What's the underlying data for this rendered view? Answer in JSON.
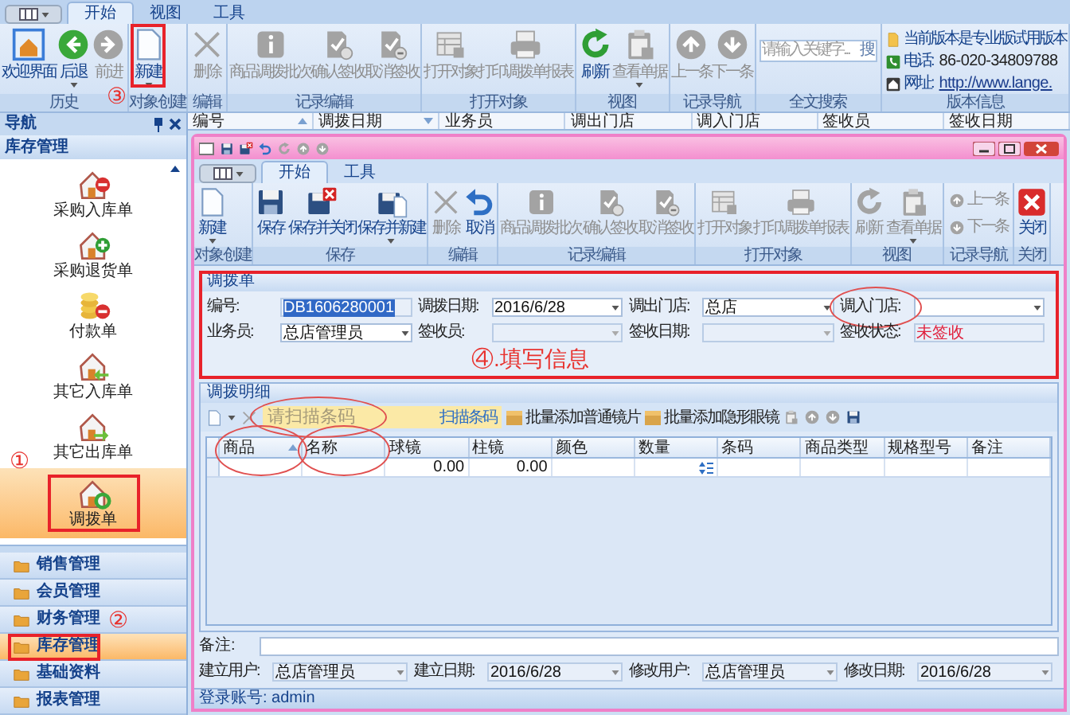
{
  "window_tabs": [
    {
      "label": "开始",
      "selected": true
    },
    {
      "label": "视图",
      "selected": false
    },
    {
      "label": "工具",
      "selected": false
    }
  ],
  "ribbon": [
    {
      "kind": "buttons",
      "label": "历史",
      "annotation": "③",
      "buttons": [
        {
          "label": "欢迎界面",
          "disabled": false,
          "dropdown": false,
          "highlighted": false
        },
        {
          "label": "后退",
          "disabled": false,
          "dropdown": true,
          "highlighted": false
        },
        {
          "label": "前进",
          "disabled": true,
          "dropdown": false,
          "highlighted": false
        }
      ]
    },
    {
      "kind": "buttons",
      "label": "对象创建",
      "buttons": [
        {
          "label": "新建",
          "disabled": false,
          "dropdown": true,
          "highlighted": true
        }
      ]
    },
    {
      "kind": "buttons",
      "label": "编辑",
      "buttons": [
        {
          "label": "删除",
          "disabled": true,
          "dropdown": false,
          "highlighted": false
        }
      ]
    },
    {
      "kind": "buttons",
      "label": "记录编辑",
      "buttons": [
        {
          "label": "商品调拨批次",
          "disabled": true,
          "dropdown": false,
          "highlighted": false
        },
        {
          "label": "确认签收",
          "disabled": true,
          "dropdown": false,
          "highlighted": false
        },
        {
          "label": "取消签收",
          "disabled": true,
          "dropdown": false,
          "highlighted": false
        }
      ]
    },
    {
      "kind": "buttons",
      "label": "打开对象",
      "buttons": [
        {
          "label": "打开对象",
          "disabled": true,
          "dropdown": false,
          "highlighted": false
        },
        {
          "label": "打印调拨单报表",
          "disabled": true,
          "dropdown": false,
          "highlighted": false
        }
      ]
    },
    {
      "kind": "buttons",
      "label": "视图",
      "buttons": [
        {
          "label": "刷新",
          "disabled": false,
          "dropdown": false,
          "highlighted": false
        },
        {
          "label": "查看单据",
          "disabled": true,
          "dropdown": true,
          "highlighted": false
        }
      ]
    },
    {
      "kind": "buttons",
      "label": "记录导航",
      "buttons": [
        {
          "label": "上一条",
          "disabled": true,
          "dropdown": false,
          "highlighted": false
        },
        {
          "label": "下一条",
          "disabled": true,
          "dropdown": false,
          "highlighted": false
        }
      ]
    },
    {
      "kind": "search",
      "label": "全文搜索",
      "placeholder": "请输入关键字...",
      "button": "搜"
    },
    {
      "kind": "info",
      "label": "版本信息",
      "lines": [
        {
          "text": "当前版本是专业版试用版本"
        },
        {
          "text": "电话:",
          "value": "86-020-34809788"
        },
        {
          "text": "网址:",
          "value": "http://www.lange."
        }
      ]
    }
  ],
  "nav": {
    "title": "导航",
    "section": "库存管理",
    "items": [
      {
        "label": "采购入库单",
        "selected": false,
        "highlighted": false
      },
      {
        "label": "采购退货单",
        "selected": false,
        "highlighted": false
      },
      {
        "label": "付款单",
        "selected": false,
        "highlighted": false
      },
      {
        "label": "其它入库单",
        "selected": false,
        "highlighted": false
      },
      {
        "label": "其它出库单",
        "selected": false,
        "highlighted": false
      },
      {
        "label": "调拨单",
        "selected": true,
        "highlighted": true,
        "annotation": "①"
      }
    ],
    "categories": [
      {
        "label": "销售管理",
        "selected": false,
        "highlighted": false
      },
      {
        "label": "会员管理",
        "selected": false,
        "highlighted": false
      },
      {
        "label": "财务管理",
        "selected": false,
        "highlighted": false,
        "annotation": "②"
      },
      {
        "label": "库存管理",
        "selected": true,
        "highlighted": true
      },
      {
        "label": "基础资料",
        "selected": false,
        "highlighted": false
      },
      {
        "label": "报表管理",
        "selected": false,
        "highlighted": false
      }
    ]
  },
  "list_columns": [
    {
      "label": "编号",
      "ascending": true,
      "descending": false
    },
    {
      "label": "调拨日期",
      "ascending": false,
      "descending": true
    },
    {
      "label": "业务员",
      "ascending": false,
      "descending": false
    },
    {
      "label": "调出门店",
      "ascending": false,
      "descending": false
    },
    {
      "label": "调入门店",
      "ascending": false,
      "descending": false
    },
    {
      "label": "签收员",
      "ascending": false,
      "descending": false
    },
    {
      "label": "签收日期",
      "ascending": false,
      "descending": false
    }
  ],
  "document": {
    "tabs": [
      {
        "label": "开始",
        "selected": true
      },
      {
        "label": "工具",
        "selected": false
      }
    ],
    "ribbon": [
      {
        "kind": "buttons",
        "label": "对象创建",
        "buttons": [
          {
            "label": "新建",
            "disabled": false,
            "dropdown": true
          }
        ]
      },
      {
        "kind": "buttons",
        "label": "保存",
        "buttons": [
          {
            "label": "保存",
            "disabled": false,
            "dropdown": false
          },
          {
            "label": "保存并关闭",
            "disabled": false,
            "dropdown": false
          },
          {
            "label": "保存并新建",
            "disabled": false,
            "dropdown": true
          }
        ]
      },
      {
        "kind": "buttons",
        "label": "编辑",
        "buttons": [
          {
            "label": "删除",
            "disabled": true,
            "dropdown": false
          },
          {
            "label": "取消",
            "disabled": false,
            "dropdown": false
          }
        ]
      },
      {
        "kind": "buttons",
        "label": "记录编辑",
        "buttons": [
          {
            "label": "商品调拨批次",
            "disabled": true,
            "dropdown": false
          },
          {
            "label": "确认签收",
            "disabled": true,
            "dropdown": false
          },
          {
            "label": "取消签收",
            "disabled": true,
            "dropdown": false
          }
        ]
      },
      {
        "kind": "buttons",
        "label": "打开对象",
        "buttons": [
          {
            "label": "打开对象",
            "disabled": true,
            "dropdown": false
          },
          {
            "label": "打印调拨单报表",
            "disabled": true,
            "dropdown": false
          }
        ]
      },
      {
        "kind": "buttons",
        "label": "视图",
        "buttons": [
          {
            "label": "刷新",
            "disabled": true,
            "dropdown": false
          },
          {
            "label": "查看单据",
            "disabled": true,
            "dropdown": true
          }
        ]
      },
      {
        "kind": "stacked",
        "label": "记录导航",
        "buttons": [
          {
            "label": "上一条",
            "disabled": true
          },
          {
            "label": "下一条",
            "disabled": true
          }
        ]
      },
      {
        "kind": "buttons",
        "label": "关闭",
        "buttons": [
          {
            "label": "关闭",
            "disabled": false,
            "dropdown": false
          }
        ]
      }
    ],
    "form": {
      "title": "调拨单",
      "highlighted": true,
      "annotation": "④.填写信息",
      "fields": [
        {
          "label": "编号:",
          "kind": "text",
          "value": "DB1606280001",
          "readonly": true,
          "value_selected": true,
          "circled": false
        },
        {
          "label": "调拨日期:",
          "kind": "combo",
          "value": "2016/6/28",
          "readonly": false,
          "value_selected": false,
          "circled": false
        },
        {
          "label": "调出门店:",
          "kind": "combo",
          "value": "总店",
          "readonly": false,
          "value_selected": false,
          "circled": false
        },
        {
          "label": "调入门店:",
          "kind": "combo",
          "readonly": false,
          "circled": true
        },
        {
          "label": "业务员:",
          "kind": "combo",
          "value": "总店管理员",
          "readonly": false,
          "value_selected": false,
          "circled": false
        },
        {
          "label": "签收员:",
          "kind": "combo",
          "readonly": true,
          "circled": false
        },
        {
          "label": "签收日期:",
          "kind": "combo",
          "readonly": true,
          "circled": false
        },
        {
          "label": "签收状态:",
          "kind": "status",
          "value": "未签收",
          "readonly": true,
          "value_selected": false,
          "circled": false
        }
      ]
    },
    "detail": {
      "title": "调拨明细",
      "scan": {
        "placeholder": "请扫描条码",
        "button": "扫描条码",
        "circled": true
      },
      "tools": [
        {
          "label": "批量添加普通镜片"
        },
        {
          "label": "批量添加隐形眼镜"
        }
      ],
      "columns": [
        {
          "label": "商品",
          "ascending": true,
          "circled": true
        },
        {
          "label": "名称",
          "ascending": false,
          "circled": true
        },
        {
          "label": "球镜",
          "ascending": false,
          "circled": false
        },
        {
          "label": "柱镜",
          "ascending": false,
          "circled": false
        },
        {
          "label": "颜色",
          "ascending": false,
          "circled": false
        },
        {
          "label": "数量",
          "ascending": false,
          "circled": false
        },
        {
          "label": "条码",
          "ascending": false,
          "circled": false
        },
        {
          "label": "商品类型",
          "ascending": false,
          "circled": false
        },
        {
          "label": "规格型号",
          "ascending": false,
          "circled": false
        },
        {
          "label": "备注",
          "ascending": false,
          "circled": false
        }
      ],
      "rows": [
        {
          "cells": [
            null,
            null,
            "0.00",
            "0.00",
            null,
            {
              "kind": "spinner"
            },
            null,
            null,
            null,
            null
          ]
        }
      ]
    },
    "remark": {
      "label": "备注:"
    },
    "audit_fields": [
      {
        "label": "建立用户:",
        "value": "总店管理员"
      },
      {
        "label": "建立日期:",
        "value": "2016/6/28"
      },
      {
        "label": "修改用户:",
        "value": "总店管理员"
      },
      {
        "label": "修改日期:",
        "value": "2016/6/28"
      }
    ],
    "status_bar": "登录账号: admin"
  }
}
